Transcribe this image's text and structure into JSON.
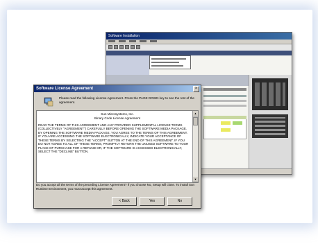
{
  "app_window": {
    "title": "Software Installation",
    "status_labels": [
      "",
      ""
    ]
  },
  "dialog": {
    "title": "Software License Agreement",
    "close_glyph": "×",
    "intro_text": "Please read the following License Agreement. Press the PAGE DOWN key to see the rest of the agreement.",
    "license_company": "Sun Microsystems, Inc.",
    "license_name": "Binary Code License Agreement",
    "license_body": "READ THE TERMS OF THIS AGREEMENT AND ANY PROVIDED SUPPLEMENTAL LICENSE TERMS (COLLECTIVELY \"AGREEMENT\") CAREFULLY BEFORE OPENING THE SOFTWARE MEDIA PACKAGE. BY OPENING THE SOFTWARE MEDIA PACKAGE, YOU AGREE TO THE TERMS OF THIS AGREEMENT. IF YOU ARE ACCESSING THE SOFTWARE ELECTRONICALLY, INDICATE YOUR ACCEPTANCE OF THESE TERMS BY SELECTING THE \"ACCEPT\" BUTTON AT THE END OF THIS AGREEMENT. IF YOU DO NOT AGREE TO ALL OF THESE TERMS, PROMPTLY RETURN THE UNUSED SOFTWARE TO YOUR PLACE OF PURCHASE FOR A REFUND OR, IF THE SOFTWARE IS ACCESSED ELECTRONICALLY, SELECT THE \"DECLINE\" BUTTON.",
    "question_text": "Do you accept all the terms of the preceding License Agreement? If you choose No, Setup will close. To install Sun Runtime Environment, you must accept this agreement.",
    "buttons": {
      "back": "< Back",
      "yes": "Yes",
      "no": "No"
    }
  },
  "colors": {
    "titlebar_start": "#0a246a",
    "titlebar_end": "#a6caf0",
    "dialog_face": "#d4d0c8",
    "glow": "#aabee1"
  }
}
